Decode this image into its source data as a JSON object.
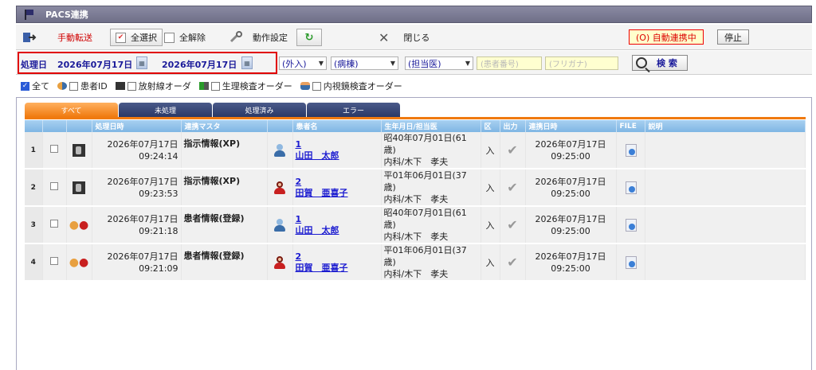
{
  "window": {
    "title": "PACS連携"
  },
  "toolbar": {
    "manual_transfer": "手動転送",
    "select_all": "全選択",
    "deselect_all": "全解除",
    "settings": "動作設定",
    "close": "閉じる",
    "auto_status": "(O) 自動連携中",
    "stop": "停止"
  },
  "filter": {
    "date_label": "処理日",
    "date_from": "2026年07月17日",
    "date_to": "2026年07月17日",
    "inout": "(外入)",
    "ward": "(病棟)",
    "doctor": "(担当医)",
    "patient_no_placeholder": "(患者番号)",
    "kana_placeholder": "(フリガナ)",
    "search": "検 索"
  },
  "categories": {
    "all": "全て",
    "patient_id": "患者ID",
    "radiology": "放射線オーダ",
    "physio": "生理検査オーダー",
    "endoscopy": "内視鏡検査オーダー"
  },
  "tabs": [
    "すべて",
    "未処理",
    "処理済み",
    "エラー"
  ],
  "columns": [
    "処理日時",
    "連携マスタ",
    "患者名",
    "生年月日/担当医",
    "区",
    "出力",
    "連携日時",
    "FILE",
    "説明"
  ],
  "rows": [
    {
      "no": "1",
      "date": "2026年07月17日",
      "time": "09:24:14",
      "master": "指示情報(XP)",
      "pid": "1",
      "pname": "山田　太郎",
      "dob": "昭40年07月01日(61歳)",
      "dept": "内科/木下　孝夫",
      "ku": "入",
      "ldate": "2026年07月17日",
      "ltime": "09:25:00"
    },
    {
      "no": "2",
      "date": "2026年07月17日",
      "time": "09:23:53",
      "master": "指示情報(XP)",
      "pid": "2",
      "pname": "田賀　亜喜子",
      "dob": "平01年06月01日(37歳)",
      "dept": "内科/木下　孝夫",
      "ku": "入",
      "ldate": "2026年07月17日",
      "ltime": "09:25:00"
    },
    {
      "no": "3",
      "date": "2026年07月17日",
      "time": "09:21:18",
      "master": "患者情報(登録)",
      "pid": "1",
      "pname": "山田　太郎",
      "dob": "昭40年07月01日(61歳)",
      "dept": "内科/木下　孝夫",
      "ku": "入",
      "ldate": "2026年07月17日",
      "ltime": "09:25:00"
    },
    {
      "no": "4",
      "date": "2026年07月17日",
      "time": "09:21:09",
      "master": "患者情報(登録)",
      "pid": "2",
      "pname": "田賀　亜喜子",
      "dob": "平01年06月01日(37歳)",
      "dept": "内科/木下　孝夫",
      "ku": "入",
      "ldate": "2026年07月17日",
      "ltime": "09:25:00"
    }
  ],
  "row_icons": [
    "xray-icon",
    "xray-icon",
    "patient-info-icon",
    "patient-info-icon"
  ],
  "row_gender": [
    "male",
    "female",
    "male",
    "female"
  ],
  "colors": {
    "accent_tab": "#f07a10",
    "header_blue": "#7fb6e4",
    "title_bar": "#6f6f88",
    "alert_red": "#d00000"
  }
}
